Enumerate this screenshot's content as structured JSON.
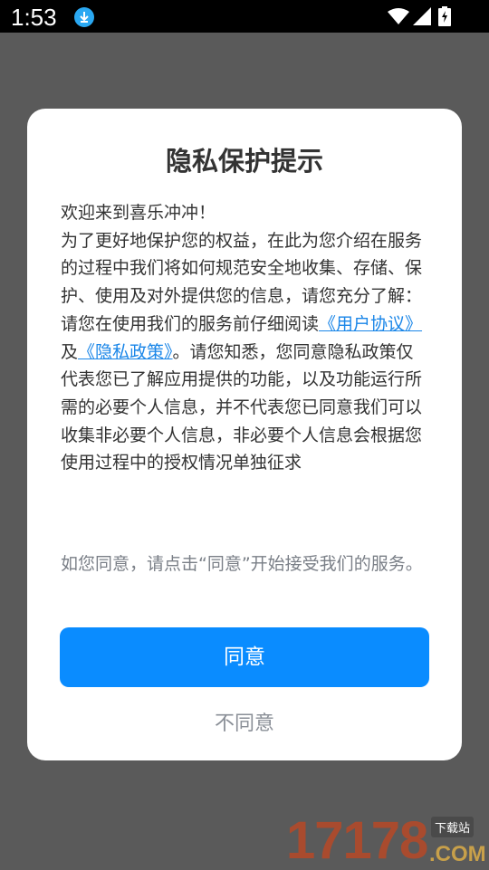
{
  "status_bar": {
    "time": "1:53"
  },
  "dialog": {
    "title": "隐私保护提示",
    "greeting": "欢迎来到喜乐冲冲！",
    "intro": "为了更好地保护您的权益，在此为您介绍在服务的过程中我们将如何规范安全地收集、存储、保护、使用及对外提供您的信息，请您充分了解：",
    "read_prefix": "请您在使用我们的服务前仔细阅读",
    "user_agreement_link": "《用户协议》",
    "and_text": "及",
    "privacy_policy_link": "《隐私政策》",
    "read_suffix": "。请您知悉，您同意隐私政策仅代表您已了解应用提供的功能，以及功能运行所需的必要个人信息，并不代表您已同意我们可以收集非必要个人信息，非必要个人信息会根据您使用过程中的授权情况单独征求",
    "note": "如您同意，请点击“同意”开始接受我们的服务。",
    "agree_label": "同意",
    "disagree_label": "不同意"
  },
  "watermark": {
    "digits": "17178",
    "badge": "下载站",
    "suffix": ".COM"
  },
  "colors": {
    "primary": "#0a8cff",
    "link": "#1a86e8",
    "overlay": "#5a5a5a"
  }
}
